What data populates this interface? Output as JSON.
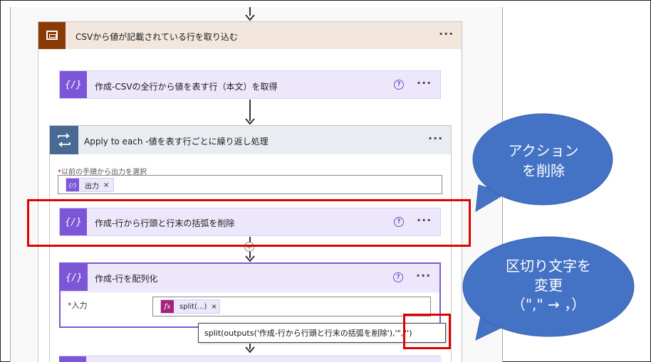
{
  "scope": {
    "title": "CSVから値が記載されている行を取り込む",
    "more": "···"
  },
  "compose_all_rows": {
    "title": "作成-CSVの全行から値を表す行（本文）を取得",
    "help": "?",
    "more": "···"
  },
  "apply_to_each": {
    "title": "Apply to each -値を表す行ごとに繰り返し処理",
    "more": "···",
    "select_label_required": "*",
    "select_label": "以前の手順から出力を選択",
    "token_label": "出力",
    "token_remove": "×"
  },
  "compose_strip_brackets": {
    "title": "作成-行から行頭と行末の括弧を削除",
    "help": "?",
    "more": "···"
  },
  "compose_split": {
    "title": "作成-行を配列化",
    "help": "?",
    "more": "···",
    "input_required": "*",
    "input_label": "入力",
    "token_label": "split(...)",
    "token_remove": "×",
    "tooltip": "split(outputs('作成-行から行頭と行末の括弧を削除'),'\",\"')"
  },
  "callouts": {
    "delete_action": {
      "line1": "アクション",
      "line2": "を削除",
      "fill": "#4472c4"
    },
    "change_delimiter": {
      "line1": "区切り文字を",
      "line2": "変更",
      "line3": "（\",\" → ，）",
      "fill": "#4472c4"
    }
  },
  "colors": {
    "highlight": "#e00000",
    "scope_header": "#f2e6dd",
    "scope_icon": "#8a3a05",
    "compose_card": "#ede7fb",
    "compose_icon": "#7b56d6",
    "loop_header": "#e9ecf1",
    "loop_icon": "#486991"
  }
}
